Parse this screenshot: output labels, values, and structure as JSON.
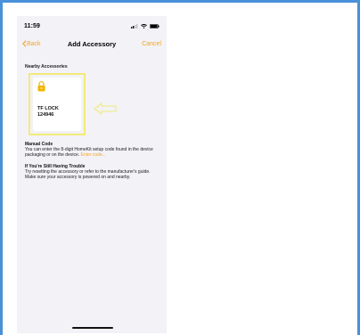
{
  "status_bar": {
    "time": "11:59"
  },
  "nav": {
    "back_label": "Back",
    "title": "Add Accessory",
    "cancel_label": "Cancel"
  },
  "nearby": {
    "heading": "Nearby Accessories",
    "accessory": {
      "name": "TF LOCK",
      "code": "124946",
      "icon": "lock-icon"
    }
  },
  "manual_code": {
    "title": "Manual Code",
    "text": "You can enter the 8-digit HomeKit setup code found in the device packaging or on the device.",
    "link": "Enter code..."
  },
  "trouble": {
    "title": "If You're Still Having Trouble",
    "text": "Try resetting the accessory or refer to the manufacturer's guide.",
    "text2": "Make sure your accessory is powered on and nearby."
  },
  "colors": {
    "accent": "#f5a623",
    "highlight": "#f3ea7a",
    "frame": "#4a90d9"
  }
}
